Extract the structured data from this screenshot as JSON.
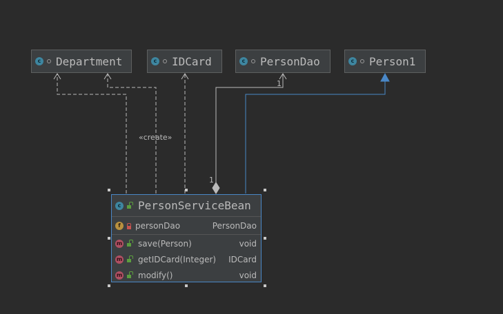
{
  "classes": {
    "department": {
      "name": "Department",
      "icon": "class-icon",
      "icon_letter": "c"
    },
    "idcard": {
      "name": "IDCard",
      "icon": "class-icon",
      "icon_letter": "c"
    },
    "persondao": {
      "name": "PersonDao",
      "icon": "class-icon",
      "icon_letter": "c"
    },
    "person1": {
      "name": "Person1",
      "icon": "class-icon",
      "icon_letter": "c"
    }
  },
  "main_class": {
    "name": "PersonServiceBean",
    "icon_letter": "c",
    "fields": [
      {
        "icon_letter": "f",
        "name": "personDao",
        "type": "PersonDao",
        "visibility": "private"
      }
    ],
    "methods": [
      {
        "icon_letter": "m",
        "name": "save(Person)",
        "type": "void",
        "visibility": "public"
      },
      {
        "icon_letter": "m",
        "name": "getIDCard(Integer)",
        "type": "IDCard",
        "visibility": "public"
      },
      {
        "icon_letter": "m",
        "name": "modify()",
        "type": "void",
        "visibility": "public"
      }
    ]
  },
  "relations": {
    "create_label": "«create»",
    "multiplicity_target": "1",
    "multiplicity_source": "1"
  },
  "colors": {
    "background": "#2b2b2b",
    "box_fill": "#3c3f41",
    "dependency_line": "#bbbbbb",
    "inheritance_line": "#4a88c7",
    "selection_border": "#4a88c7"
  }
}
